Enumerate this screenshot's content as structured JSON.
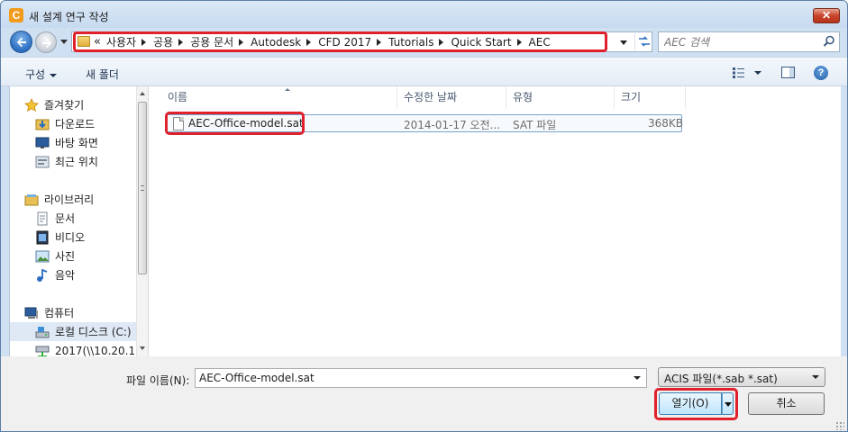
{
  "window": {
    "title": "새 설계 연구 작성",
    "app_icon_letter": "C",
    "close_symbol": "✕"
  },
  "address": {
    "chevron": "«",
    "crumbs": [
      "사용자",
      "공용",
      "공용 문서",
      "Autodesk",
      "CFD 2017",
      "Tutorials",
      "Quick Start",
      "AEC"
    ]
  },
  "search": {
    "placeholder": "AEC 검색"
  },
  "toolbar": {
    "organize": "구성",
    "new_folder": "새 폴더",
    "help": "?"
  },
  "nav": {
    "items": [
      {
        "label": "즐겨찾기",
        "icon": "star-icon"
      },
      {
        "label": "다운로드",
        "icon": "downloads-icon"
      },
      {
        "label": "바탕 화면",
        "icon": "desktop-icon"
      },
      {
        "label": "최근 위치",
        "icon": "recent-places-icon"
      },
      {
        "label": "라이브러리",
        "icon": "library-icon"
      },
      {
        "label": "문서",
        "icon": "documents-icon"
      },
      {
        "label": "비디오",
        "icon": "video-icon"
      },
      {
        "label": "사진",
        "icon": "pictures-icon"
      },
      {
        "label": "음악",
        "icon": "music-icon"
      },
      {
        "label": "컴퓨터",
        "icon": "computer-icon"
      },
      {
        "label": "로컬 디스크 (C:)",
        "icon": "local-disk-icon"
      },
      {
        "label": "2017(\\\\10.20.1",
        "icon": "network-drive-icon"
      }
    ]
  },
  "columns": [
    "이름",
    "수정한 날짜",
    "유형",
    "크기"
  ],
  "files": [
    {
      "name": "AEC-Office-model.sat",
      "modified": "2014-01-17 오전...",
      "type": "SAT 파일",
      "size": "368KB"
    }
  ],
  "bottom": {
    "filename_label": "파일 이름(N):",
    "filename_value": "AEC-Office-model.sat",
    "filetype": "ACIS 파일(*.sab *.sat)",
    "open_label": "열기(O)",
    "cancel_label": "취소"
  },
  "colors": {
    "highlight": "#e0202b",
    "accent": "#2a6cc0"
  }
}
